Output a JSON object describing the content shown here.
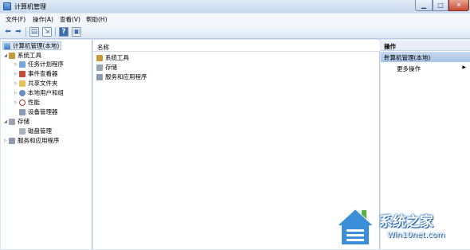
{
  "window": {
    "title": "计算机管理"
  },
  "menu": [
    "文件(F)",
    "操作(A)",
    "查看(V)",
    "帮助(H)"
  ],
  "tree": {
    "root": "计算机管理(本地)",
    "items": [
      {
        "label": "系统工具",
        "level": 1,
        "expanded": true
      },
      {
        "label": "任务计划程序",
        "level": 2
      },
      {
        "label": "事件查看器",
        "level": 2
      },
      {
        "label": "共享文件夹",
        "level": 2
      },
      {
        "label": "本地用户和组",
        "level": 2
      },
      {
        "label": "性能",
        "level": 2
      },
      {
        "label": "设备管理器",
        "level": 2
      },
      {
        "label": "存储",
        "level": 1,
        "expanded": true
      },
      {
        "label": "磁盘管理",
        "level": 2
      },
      {
        "label": "服务和应用程序",
        "level": 1
      }
    ]
  },
  "list": {
    "column_header": "名称",
    "items": [
      "系统工具",
      "存储",
      "服务和应用程序"
    ]
  },
  "actions": {
    "header": "操作",
    "section": "计算机管理(本地)",
    "more": "更多操作"
  },
  "watermark": {
    "cn": "系统之家",
    "en": "Win10net.com"
  }
}
